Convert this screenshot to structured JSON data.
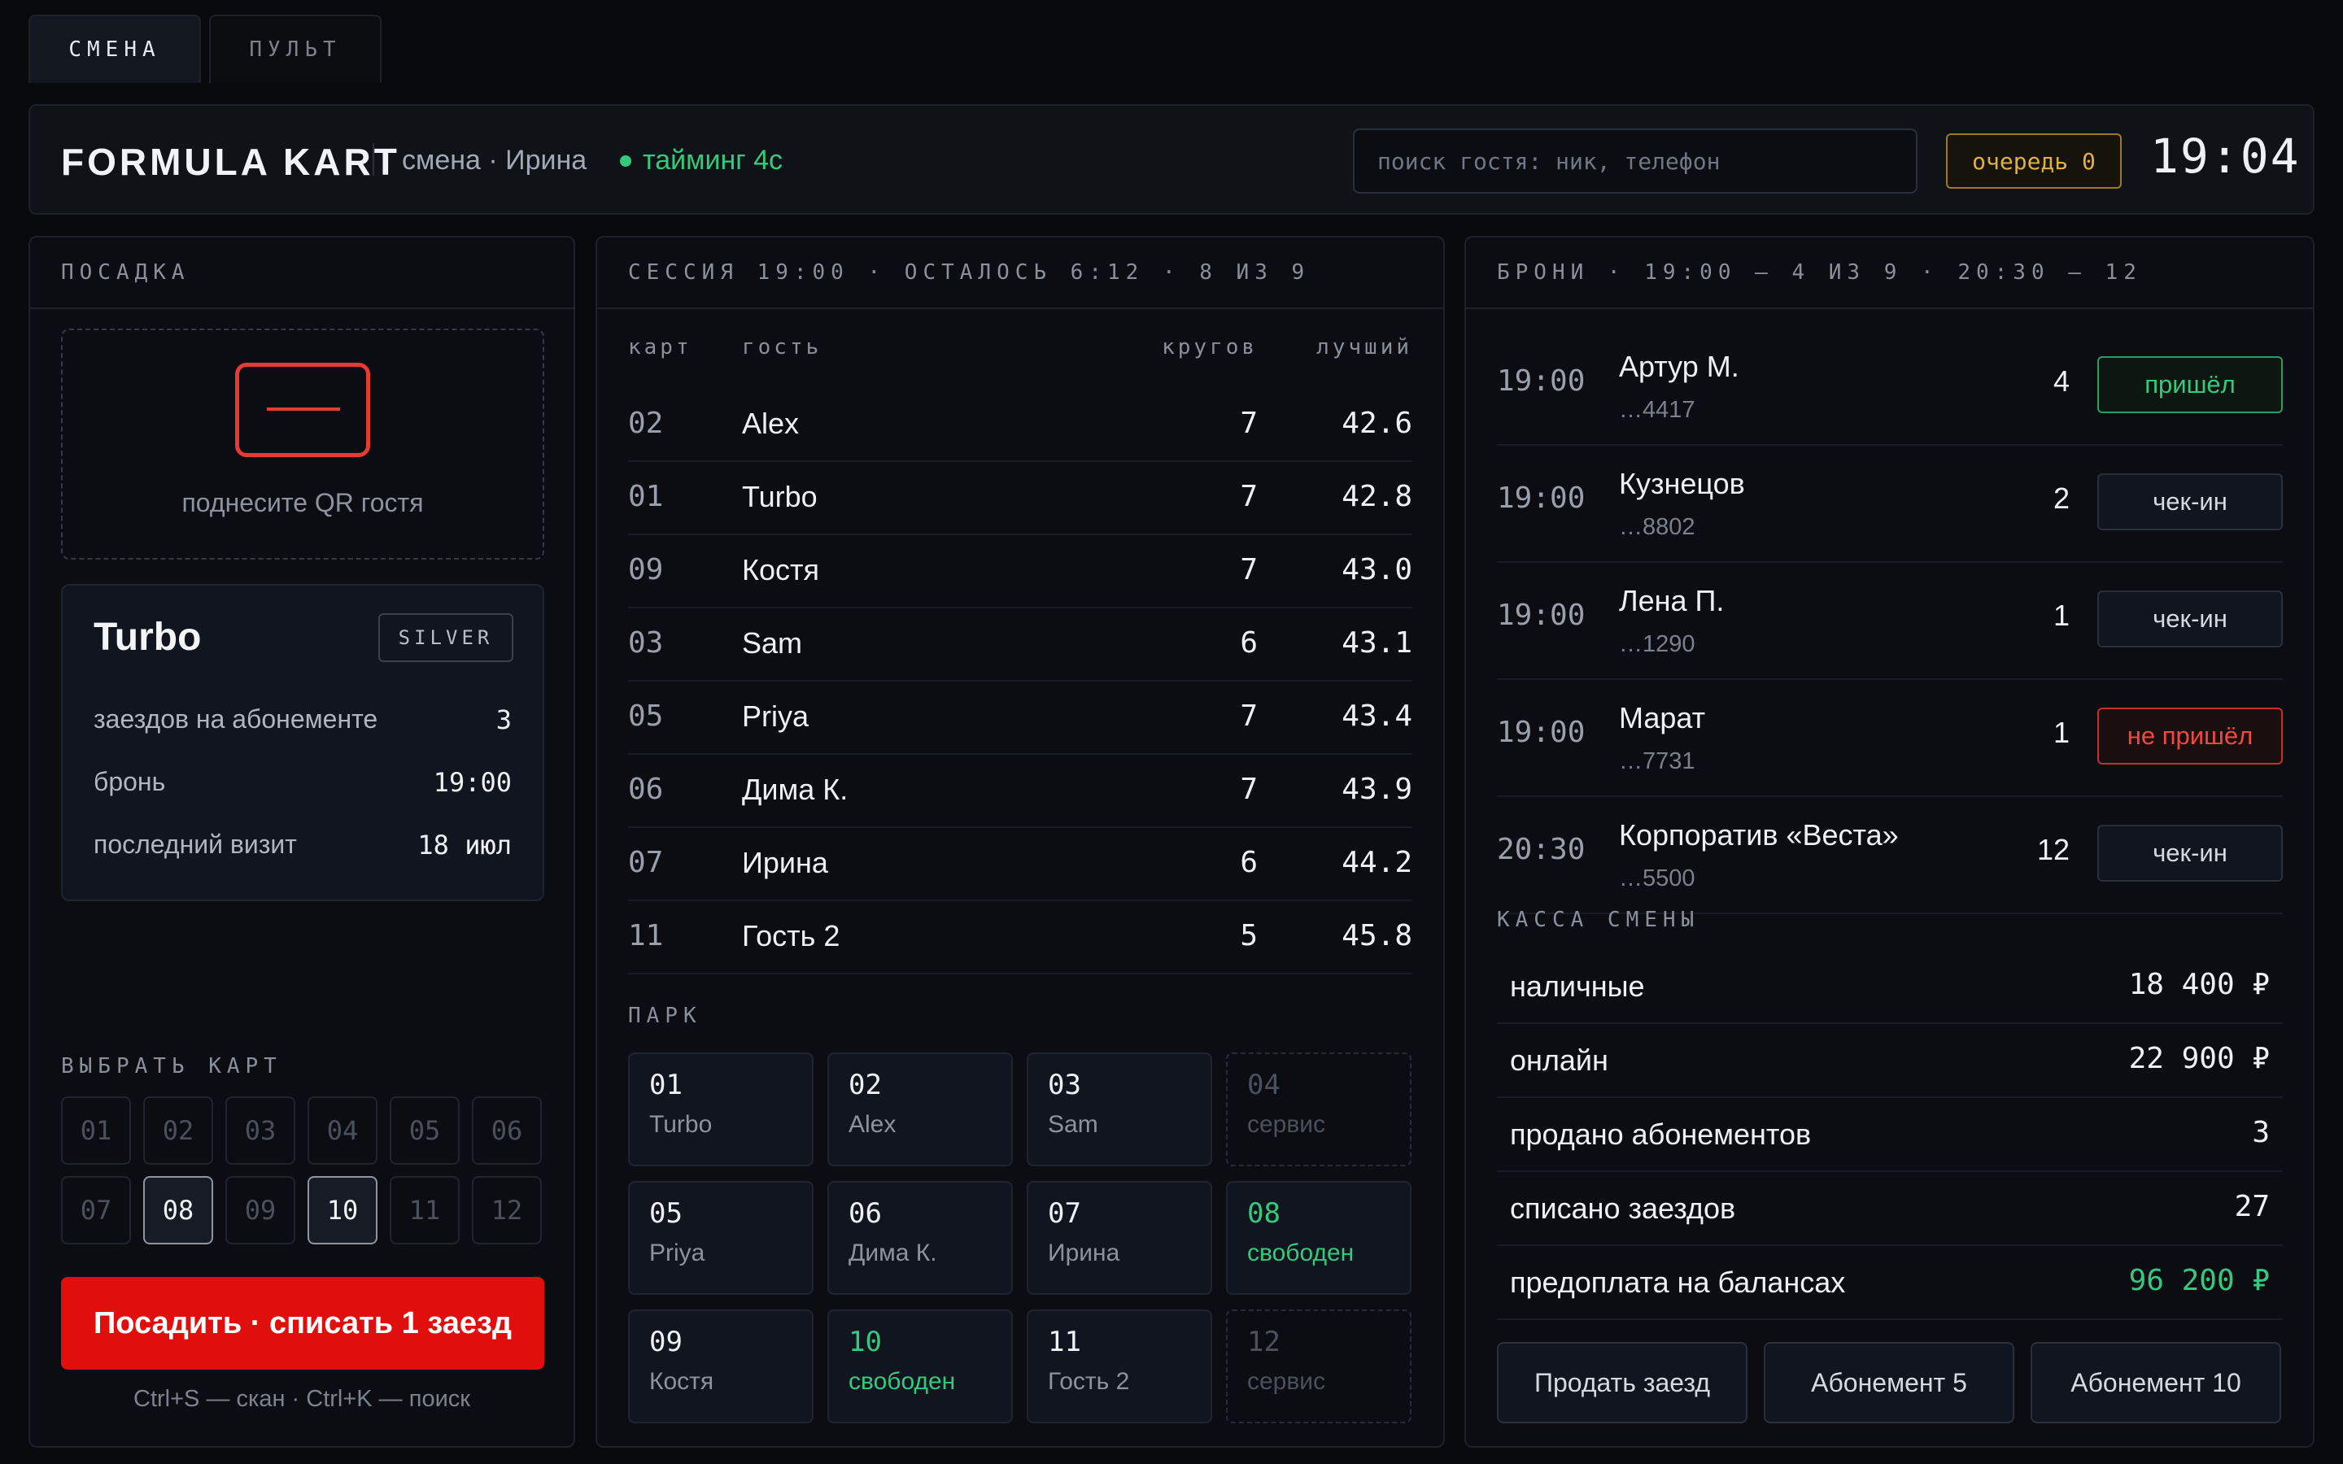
{
  "tabs": [
    "СМЕНА",
    "ПУЛЬТ"
  ],
  "header": {
    "brand": "FORMULA KART",
    "shift": "смена · Ирина",
    "timing": "тайминг 4с",
    "search_placeholder": "поиск гостя: ник, телефон",
    "queue": "очередь 0",
    "clock": "19:04"
  },
  "colors": {
    "accent_red": "#e10e0e",
    "ok_green": "#36c97d",
    "queue_amber": "#e0b23f"
  },
  "left": {
    "title": "ПОСАДКА",
    "qr_icon": "qr-scan-icon",
    "qr_text": "поднесите QR гостя",
    "guest": {
      "name": "Turbo",
      "tier": "SILVER",
      "rows": [
        {
          "label": "заездов на абонементе",
          "value": "3"
        },
        {
          "label": "бронь",
          "value": "19:00"
        },
        {
          "label": "последний визит",
          "value": "18 июл"
        }
      ]
    },
    "kart_label": "ВЫБРАТЬ КАРТ",
    "karts": [
      "01",
      "02",
      "03",
      "04",
      "05",
      "06",
      "07",
      "08",
      "09",
      "10",
      "11",
      "12"
    ],
    "selected_karts": [
      "08",
      "10"
    ],
    "seat_button": "Посадить · списать 1 заезд",
    "hint": "Ctrl+S — скан · Ctrl+K — поиск"
  },
  "middle": {
    "title": "СЕССИЯ 19:00 · ОСТАЛОСЬ 6:12 · 8 ИЗ 9",
    "columns": [
      "карт",
      "гость",
      "кругов",
      "лучший"
    ],
    "rows": [
      {
        "kart": "02",
        "guest": "Alex",
        "laps": "7",
        "best": "42.6"
      },
      {
        "kart": "01",
        "guest": "Turbo",
        "laps": "7",
        "best": "42.8"
      },
      {
        "kart": "09",
        "guest": "Костя",
        "laps": "7",
        "best": "43.0"
      },
      {
        "kart": "03",
        "guest": "Sam",
        "laps": "6",
        "best": "43.1"
      },
      {
        "kart": "05",
        "guest": "Priya",
        "laps": "7",
        "best": "43.4"
      },
      {
        "kart": "06",
        "guest": "Дима К.",
        "laps": "7",
        "best": "43.9"
      },
      {
        "kart": "07",
        "guest": "Ирина",
        "laps": "6",
        "best": "44.2"
      },
      {
        "kart": "11",
        "guest": "Гость 2",
        "laps": "5",
        "best": "45.8"
      }
    ],
    "park_label": "ПАРК",
    "park": [
      {
        "num": "01",
        "status": "Turbo",
        "state": "busy"
      },
      {
        "num": "02",
        "status": "Alex",
        "state": "busy"
      },
      {
        "num": "03",
        "status": "Sam",
        "state": "busy"
      },
      {
        "num": "04",
        "status": "сервис",
        "state": "svc"
      },
      {
        "num": "05",
        "status": "Priya",
        "state": "busy"
      },
      {
        "num": "06",
        "status": "Дима К.",
        "state": "busy"
      },
      {
        "num": "07",
        "status": "Ирина",
        "state": "busy"
      },
      {
        "num": "08",
        "status": "свободен",
        "state": "free"
      },
      {
        "num": "09",
        "status": "Костя",
        "state": "busy"
      },
      {
        "num": "10",
        "status": "свободен",
        "state": "free"
      },
      {
        "num": "11",
        "status": "Гость 2",
        "state": "busy"
      },
      {
        "num": "12",
        "status": "сервис",
        "state": "svc"
      }
    ]
  },
  "right": {
    "title": "БРОНИ · 19:00 — 4 ИЗ 9 · 20:30 — 12",
    "bookings": [
      {
        "time": "19:00",
        "name": "Артур М.",
        "phone": "…4417",
        "count": "4",
        "status": "пришёл",
        "state": "came"
      },
      {
        "time": "19:00",
        "name": "Кузнецов",
        "phone": "…8802",
        "count": "2",
        "status": "чек-ин",
        "state": "checkin"
      },
      {
        "time": "19:00",
        "name": "Лена П.",
        "phone": "…1290",
        "count": "1",
        "status": "чек-ин",
        "state": "checkin"
      },
      {
        "time": "19:00",
        "name": "Марат",
        "phone": "…7731",
        "count": "1",
        "status": "не пришёл",
        "state": "noshow"
      },
      {
        "time": "20:30",
        "name": "Корпоратив «Веста»",
        "phone": "…5500",
        "count": "12",
        "status": "чек-ин",
        "state": "checkin"
      }
    ],
    "cash_label": "КАССА СМЕНЫ",
    "cash": [
      {
        "label": "наличные",
        "value": "18 400 ₽"
      },
      {
        "label": "онлайн",
        "value": "22 900 ₽"
      },
      {
        "label": "продано абонементов",
        "value": "3"
      },
      {
        "label": "списано заездов",
        "value": "27"
      },
      {
        "label": "предоплата на балансах",
        "value": "96 200 ₽"
      }
    ],
    "actions": [
      "Продать заезд",
      "Абонемент 5",
      "Абонемент 10"
    ]
  }
}
